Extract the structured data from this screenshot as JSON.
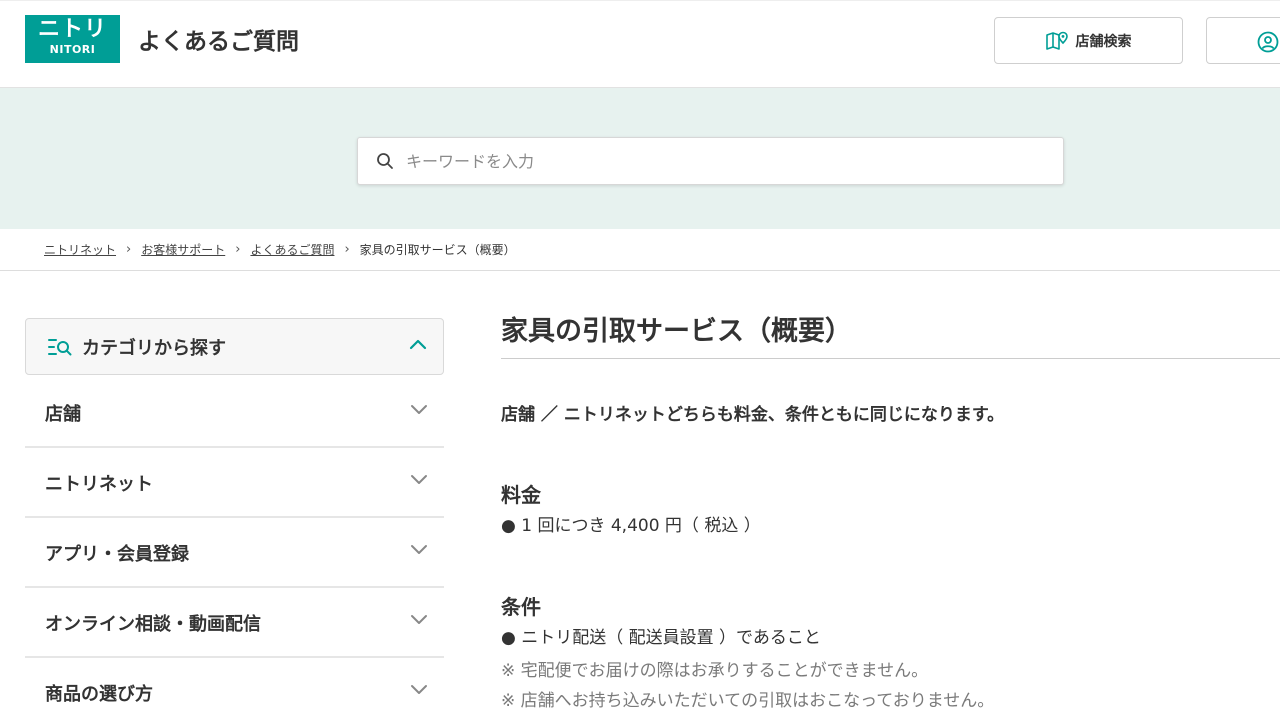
{
  "header": {
    "logo_top": "ニトリ",
    "logo_bottom": "NITORI",
    "title": "よくあるご質問",
    "store_search_label": "店舗検索"
  },
  "search": {
    "placeholder": "キーワードを入力"
  },
  "breadcrumb": {
    "items": [
      "ニトリネット",
      "お客様サポート",
      "よくあるご質問"
    ],
    "current": "家具の引取サービス（概要）"
  },
  "sidebar": {
    "header_label": "カテゴリから探す",
    "items": [
      {
        "label": "店舗"
      },
      {
        "label": "ニトリネット"
      },
      {
        "label": "アプリ・会員登録"
      },
      {
        "label": "オンライン相談・動画配信"
      },
      {
        "label": "商品の選び方"
      }
    ]
  },
  "content": {
    "title": "家具の引取サービス（概要）",
    "lead": "店舗 ／ ニトリネットどちらも料金、条件ともに同じになります。",
    "price_heading": "料金",
    "price_text": "● 1 回につき 4,400 円（ 税込 ）",
    "condition_heading": "条件",
    "condition_text": "● ニトリ配送（ 配送員設置 ）であること",
    "notes": [
      "※ 宅配便でお届けの際はお承りすることができません。",
      "※ 店舗へお持ち込みいただいての引取はおこなっておりません。"
    ]
  },
  "colors": {
    "brand": "#009e96",
    "search_band": "#e7f2ef",
    "note_text": "#7a7a7a"
  }
}
